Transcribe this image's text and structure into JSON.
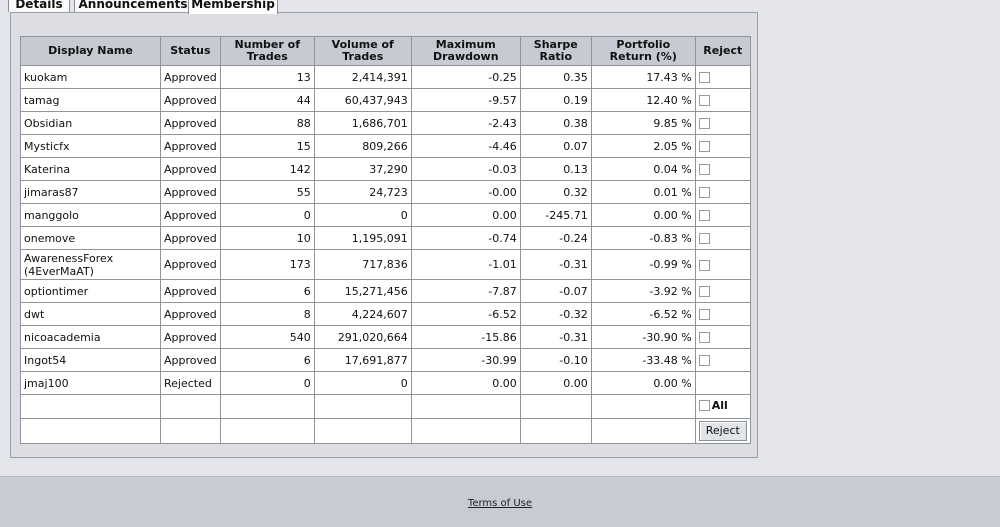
{
  "tabs": [
    "Details",
    "Announcements",
    "Membership"
  ],
  "table": {
    "headers": [
      "Display Name",
      "Status",
      "Number of Trades",
      "Volume of Trades",
      "Maximum Drawdown",
      "Sharpe Ratio",
      "Portfolio Return (%)",
      "Reject"
    ],
    "rows": [
      {
        "name": "kuokam",
        "status": "Approved",
        "trades": "13",
        "volume": "2,414,391",
        "drawdown": "-0.25",
        "sharpe": "0.35",
        "return": "17.43 %",
        "checkbox": true
      },
      {
        "name": "tamag",
        "status": "Approved",
        "trades": "44",
        "volume": "60,437,943",
        "drawdown": "-9.57",
        "sharpe": "0.19",
        "return": "12.40 %",
        "checkbox": true
      },
      {
        "name": "Obsidian",
        "status": "Approved",
        "trades": "88",
        "volume": "1,686,701",
        "drawdown": "-2.43",
        "sharpe": "0.38",
        "return": "9.85 %",
        "checkbox": true
      },
      {
        "name": "Mysticfx",
        "status": "Approved",
        "trades": "15",
        "volume": "809,266",
        "drawdown": "-4.46",
        "sharpe": "0.07",
        "return": "2.05 %",
        "checkbox": true
      },
      {
        "name": "Katerina",
        "status": "Approved",
        "trades": "142",
        "volume": "37,290",
        "drawdown": "-0.03",
        "sharpe": "0.13",
        "return": "0.04 %",
        "checkbox": true
      },
      {
        "name": "jimaras87",
        "status": "Approved",
        "trades": "55",
        "volume": "24,723",
        "drawdown": "-0.00",
        "sharpe": "0.32",
        "return": "0.01 %",
        "checkbox": true
      },
      {
        "name": "manggolo",
        "status": "Approved",
        "trades": "0",
        "volume": "0",
        "drawdown": "0.00",
        "sharpe": "-245.71",
        "return": "0.00 %",
        "checkbox": true
      },
      {
        "name": "onemove",
        "status": "Approved",
        "trades": "10",
        "volume": "1,195,091",
        "drawdown": "-0.74",
        "sharpe": "-0.24",
        "return": "-0.83 %",
        "checkbox": true
      },
      {
        "name": "AwarenessForex (4EverMaAT)",
        "status": "Approved",
        "trades": "173",
        "volume": "717,836",
        "drawdown": "-1.01",
        "sharpe": "-0.31",
        "return": "-0.99 %",
        "checkbox": true
      },
      {
        "name": "optiontimer",
        "status": "Approved",
        "trades": "6",
        "volume": "15,271,456",
        "drawdown": "-7.87",
        "sharpe": "-0.07",
        "return": "-3.92 %",
        "checkbox": true
      },
      {
        "name": "dwt",
        "status": "Approved",
        "trades": "8",
        "volume": "4,224,607",
        "drawdown": "-6.52",
        "sharpe": "-0.32",
        "return": "-6.52 %",
        "checkbox": true
      },
      {
        "name": "nicoacademia",
        "status": "Approved",
        "trades": "540",
        "volume": "291,020,664",
        "drawdown": "-15.86",
        "sharpe": "-0.31",
        "return": "-30.90 %",
        "checkbox": true
      },
      {
        "name": "Ingot54",
        "status": "Approved",
        "trades": "6",
        "volume": "17,691,877",
        "drawdown": "-30.99",
        "sharpe": "-0.10",
        "return": "-33.48 %",
        "checkbox": true
      },
      {
        "name": "jmaj100",
        "status": "Rejected",
        "trades": "0",
        "volume": "0",
        "drawdown": "0.00",
        "sharpe": "0.00",
        "return": "0.00 %",
        "checkbox": false
      }
    ],
    "select_all_label": "All",
    "reject_button_label": "Reject"
  },
  "footer": {
    "terms_link": "Terms of Use"
  }
}
